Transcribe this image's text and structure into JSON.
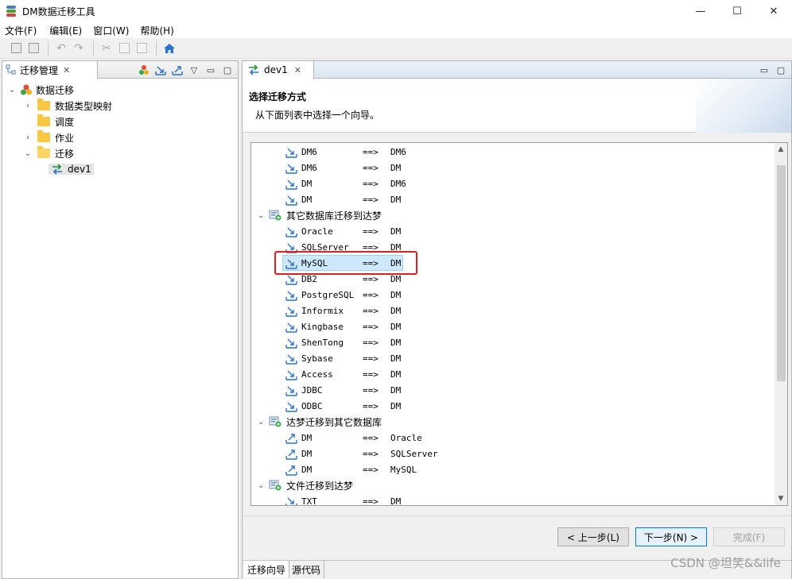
{
  "window": {
    "title": "DM数据迁移工具",
    "controls": {
      "minimize": "—",
      "maximize": "☐",
      "close": "✕"
    }
  },
  "menu": [
    "文件(F)",
    "编辑(E)",
    "窗口(W)",
    "帮助(H)"
  ],
  "left_view": {
    "tab_label": "迁移管理",
    "tab_close": "✕",
    "tree": {
      "root": "数据迁移",
      "children": [
        "数据类型映射",
        "调度",
        "作业",
        "迁移"
      ],
      "migration_child": "dev1"
    }
  },
  "editor": {
    "tab_label": "dev1",
    "tab_close": "✕",
    "wizard": {
      "title": "选择迁移方式",
      "description": "从下面列表中选择一个向导。"
    },
    "list": {
      "arrow_text": "==>",
      "dm6_rows": [
        {
          "src": "DM6",
          "dst": "DM6"
        },
        {
          "src": "DM6",
          "dst": "DM"
        },
        {
          "src": "DM",
          "dst": "DM6"
        },
        {
          "src": "DM",
          "dst": "DM"
        }
      ],
      "groups": [
        {
          "label": "其它数据库迁移到达梦",
          "rows": [
            {
              "src": "Oracle",
              "dst": "DM"
            },
            {
              "src": "SQLServer",
              "dst": "DM"
            },
            {
              "src": "MySQL",
              "dst": "DM"
            },
            {
              "src": "DB2",
              "dst": "DM"
            },
            {
              "src": "PostgreSQL",
              "dst": "DM"
            },
            {
              "src": "Informix",
              "dst": "DM"
            },
            {
              "src": "Kingbase",
              "dst": "DM"
            },
            {
              "src": "ShenTong",
              "dst": "DM"
            },
            {
              "src": "Sybase",
              "dst": "DM"
            },
            {
              "src": "Access",
              "dst": "DM"
            },
            {
              "src": "JDBC",
              "dst": "DM"
            },
            {
              "src": "ODBC",
              "dst": "DM"
            }
          ]
        },
        {
          "label": "达梦迁移到其它数据库",
          "rows": [
            {
              "src": "DM",
              "dst": "Oracle"
            },
            {
              "src": "DM",
              "dst": "SQLServer"
            },
            {
              "src": "DM",
              "dst": "MySQL"
            }
          ]
        },
        {
          "label": "文件迁移到达梦",
          "rows": [
            {
              "src": "TXT",
              "dst": "DM"
            }
          ]
        }
      ]
    },
    "buttons": {
      "back": "< 上一步(L)",
      "next": "下一步(N) >",
      "finish": "完成(F)"
    },
    "bottom_tabs": [
      "迁移向导",
      "源代码"
    ]
  },
  "watermark": "CSDN @坦笑&&life",
  "colors": {
    "selection": "#cde8ff",
    "highlight_box": "#e02020",
    "folder": "#f8c842",
    "default_button_border": "#0078d7"
  }
}
